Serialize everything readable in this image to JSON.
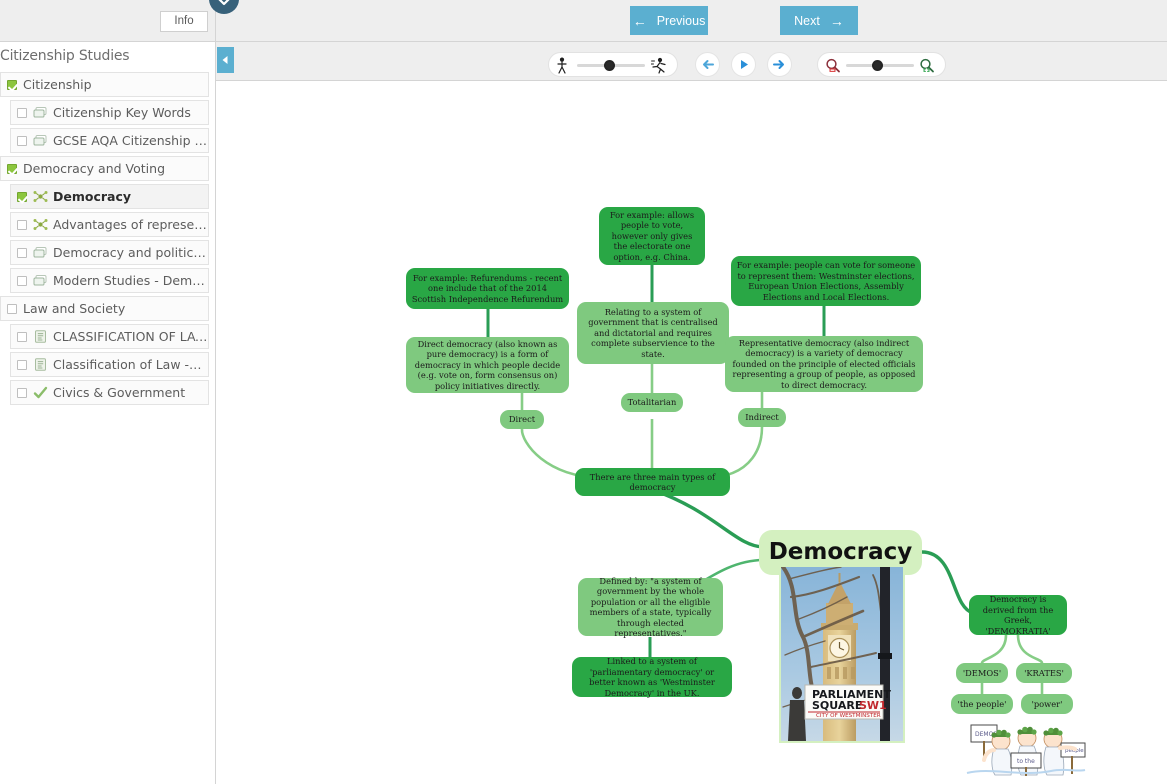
{
  "topbar": {
    "info_label": "Info",
    "previous_label": "Previous",
    "next_label": "Next",
    "previous_arrow": "←",
    "next_arrow": "→",
    "accent_color": "#5bafd0",
    "badge_color": "#37617a"
  },
  "toolbar": {
    "speed_slider": {
      "icon_left": "walking-figure-icon",
      "icon_right": "running-figure-icon",
      "value_percent": 50
    },
    "step_back": "step-back-icon",
    "play": "play-icon",
    "step_forward": "step-forward-icon",
    "zoom_slider": {
      "icon_left": "zoom-out-icon",
      "icon_right": "zoom-in-icon",
      "value_percent": 50
    }
  },
  "sidebar": {
    "title": "Citizenship Studies",
    "items": [
      {
        "label": "Citizenship",
        "level": 0,
        "checked": true,
        "icon": "none",
        "selected": false
      },
      {
        "label": "Citizenship Key Words",
        "level": 1,
        "checked": false,
        "icon": "card-icon",
        "selected": false
      },
      {
        "label": "GCSE AQA Citizenship Studies:...",
        "level": 1,
        "checked": false,
        "icon": "card-icon",
        "selected": false
      },
      {
        "label": "Democracy and Voting",
        "level": 0,
        "checked": true,
        "icon": "none",
        "selected": false
      },
      {
        "label": "Democracy",
        "level": 1,
        "checked": true,
        "icon": "mindmap-icon",
        "selected": true
      },
      {
        "label": "Advantages of representative...",
        "level": 1,
        "checked": false,
        "icon": "mindmap-icon",
        "selected": false
      },
      {
        "label": "Democracy and political partic...",
        "level": 1,
        "checked": false,
        "icon": "card-icon",
        "selected": false
      },
      {
        "label": "Modern Studies - Democracy i...",
        "level": 1,
        "checked": false,
        "icon": "card-icon",
        "selected": false
      },
      {
        "label": "Law and Society",
        "level": 0,
        "checked": false,
        "icon": "none",
        "selected": false
      },
      {
        "label": "CLASSIFICATION OF LAWS",
        "level": 1,
        "checked": false,
        "icon": "note-icon",
        "selected": false
      },
      {
        "label": "Classification of Law -English L...",
        "level": 1,
        "checked": false,
        "icon": "note-icon",
        "selected": false
      },
      {
        "label": "Civics & Government",
        "level": 1,
        "checked": false,
        "icon": "quiz-icon",
        "selected": false
      }
    ]
  },
  "mindmap": {
    "root": {
      "label": "Democracy"
    },
    "nodes": [
      {
        "id": "ex-totalitarian",
        "label": "For example: allows people to vote, however only gives the electorate one option, e.g. China.",
        "shade": "dark"
      },
      {
        "id": "ex-direct",
        "label": "For example: Refurendums - recent one include that of the 2014 Scottish Independence Refurendum",
        "shade": "dark"
      },
      {
        "id": "ex-indirect",
        "label": "For example: people can vote for someone to represent them: Westminster elections, European Union Elections, Assembly Elections and Local Elections.",
        "shade": "dark"
      },
      {
        "id": "def-totalitarian",
        "label": "Relating to a system of government that is centralised and dictatorial and requires complete subservience to the state.",
        "shade": "light"
      },
      {
        "id": "def-direct",
        "label": "Direct democracy (also known as pure democracy) is a form of democracy in which people decide (e.g. vote on, form consensus on) policy initiatives directly.",
        "shade": "light"
      },
      {
        "id": "def-indirect",
        "label": "Representative democracy (also indirect democracy) is a variety of democracy founded on the principle of elected officials representing a group of people, as opposed to direct democracy.",
        "shade": "light"
      },
      {
        "id": "direct",
        "label": "Direct",
        "shade": "light"
      },
      {
        "id": "totalitarian",
        "label": "Totalitarian",
        "shade": "light"
      },
      {
        "id": "indirect",
        "label": "Indirect",
        "shade": "light"
      },
      {
        "id": "three-types",
        "label": "There are three main types of democracy",
        "shade": "dark"
      },
      {
        "id": "defined-by",
        "label": "Defined by: \"a system of government by the whole population or all the eligible members of a state, typically through elected representatives.\"",
        "shade": "light"
      },
      {
        "id": "linked-to",
        "label": "Linked to a system of 'parliamentary democracy' or better known as 'Westminster Democracy' in the UK.",
        "shade": "dark"
      },
      {
        "id": "greek-origin",
        "label": "Democracy is derived from the Greek, 'DEMOKRATIA'",
        "shade": "dark"
      },
      {
        "id": "demos",
        "label": "'DEMOS'",
        "shade": "light"
      },
      {
        "id": "krates",
        "label": "'KRATES'",
        "shade": "light"
      },
      {
        "id": "the-people",
        "label": "'the people'",
        "shade": "light"
      },
      {
        "id": "power",
        "label": "'power'",
        "shade": "light"
      }
    ],
    "images": [
      {
        "id": "bigben-photo",
        "alt": "Photo of Big Ben behind a Parliament Square SW1 City of Westminster street sign",
        "sign_line1": "PARLIAMENT",
        "sign_line2": "SQUARE",
        "sign_code": "SW1",
        "sign_line3": "CITY OF WESTMINSTER"
      },
      {
        "id": "greek-cartoon",
        "alt": "Cartoon of three Greek figures in laurel wreaths holding placards"
      }
    ],
    "colors": {
      "dark": "#29a745",
      "light": "#7fc97f",
      "pale": "#d4f0c0",
      "edge_dark": "#2a9d55",
      "edge_light": "#86cd86"
    }
  }
}
